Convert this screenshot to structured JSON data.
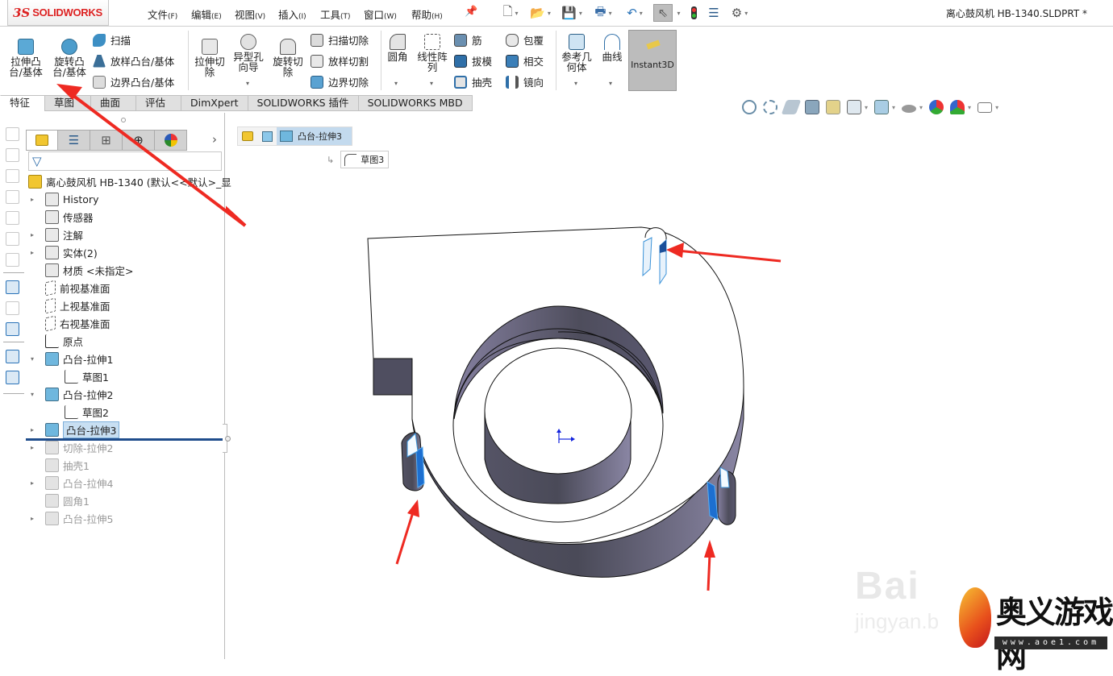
{
  "app": {
    "logo_ds": "3S",
    "logo_text": "SOLIDWORKS",
    "document_title": "离心鼓风机 HB-1340.SLDPRT *"
  },
  "menu": [
    {
      "label": "文件",
      "key": "(F)"
    },
    {
      "label": "编辑",
      "key": "(E)"
    },
    {
      "label": "视图",
      "key": "(V)"
    },
    {
      "label": "插入",
      "key": "(I)"
    },
    {
      "label": "工具",
      "key": "(T)"
    },
    {
      "label": "窗口",
      "key": "(W)"
    },
    {
      "label": "帮助",
      "key": "(H)"
    }
  ],
  "quick_access": [
    "new-icon",
    "open-icon",
    "save-icon",
    "print-icon",
    "undo-icon",
    "select-icon",
    "rebuild-icon",
    "file-properties-icon",
    "options-icon"
  ],
  "ribbon": {
    "large": [
      {
        "label": "拉伸凸台/基体",
        "lines": [
          "拉伸凸",
          "台/基体"
        ]
      },
      {
        "label": "旋转凸台/基体",
        "lines": [
          "旋转凸",
          "台/基体"
        ]
      },
      {
        "label": "拉伸切除",
        "lines": [
          "拉伸切",
          "除"
        ]
      },
      {
        "label": "异型孔向导",
        "lines": [
          "异型孔",
          "向导"
        ]
      },
      {
        "label": "旋转切除",
        "lines": [
          "旋转切",
          "除"
        ]
      },
      {
        "label": "圆角",
        "lines": [
          "圆角"
        ]
      },
      {
        "label": "线性阵列",
        "lines": [
          "线性阵",
          "列"
        ]
      },
      {
        "label": "参考几何体",
        "lines": [
          "参考几",
          "何体"
        ]
      },
      {
        "label": "曲线",
        "lines": [
          "曲线"
        ]
      },
      {
        "label": "Instant3D",
        "lines": [
          "Instant3D"
        ]
      }
    ],
    "small": {
      "sweep": "扫描",
      "loft": "放样凸台/基体",
      "boundary": "边界凸台/基体",
      "sweep_cut": "扫描切除",
      "loft_cut": "放样切割",
      "boundary_cut": "边界切除",
      "rib": "筋",
      "draft": "拔模",
      "shell": "抽壳",
      "wrap": "包覆",
      "intersect": "相交",
      "mirror": "镜向"
    }
  },
  "tabs": [
    {
      "label": "特征",
      "active": true
    },
    {
      "label": "草图"
    },
    {
      "label": "曲面"
    },
    {
      "label": "评估"
    },
    {
      "label": "DimXpert"
    },
    {
      "label": "SOLIDWORKS 插件"
    },
    {
      "label": "SOLIDWORKS MBD"
    }
  ],
  "view_toolbar": [
    "zoom-to-fit-icon",
    "zoom-to-area-icon",
    "previous-view-icon",
    "section-view-icon",
    "dynamic-annotation-icon",
    "view-orientation-icon",
    "display-style-icon",
    "hide-show-icon",
    "edit-appearance-icon",
    "apply-scene-icon",
    "view-settings-icon"
  ],
  "panel_tabs": [
    "feature-manager-icon",
    "property-manager-icon",
    "configuration-manager-icon",
    "dimxpert-manager-icon",
    "display-manager-icon"
  ],
  "tree": {
    "root": "离心鼓风机 HB-1340  (默认<<默认>_显",
    "items": [
      {
        "label": "History",
        "icon": "history-folder-icon",
        "expander": true
      },
      {
        "label": "传感器",
        "icon": "sensors-folder-icon"
      },
      {
        "label": "注解",
        "icon": "annotations-folder-icon",
        "expander": true
      },
      {
        "label": "实体(2)",
        "icon": "solid-bodies-folder-icon",
        "expander": true
      },
      {
        "label": "材质 <未指定>",
        "icon": "material-icon"
      },
      {
        "label": "前视基准面",
        "icon": "plane-icon"
      },
      {
        "label": "上视基准面",
        "icon": "plane-icon"
      },
      {
        "label": "右视基准面",
        "icon": "plane-icon"
      },
      {
        "label": "原点",
        "icon": "origin-icon"
      },
      {
        "label": "凸台-拉伸1",
        "icon": "extrude-icon",
        "expanded": true
      },
      {
        "label": "草图1",
        "icon": "sketch-icon",
        "child": true
      },
      {
        "label": "凸台-拉伸2",
        "icon": "extrude-icon",
        "expanded": true
      },
      {
        "label": "草图2",
        "icon": "sketch-icon",
        "child": true
      },
      {
        "label": "凸台-拉伸3",
        "icon": "extrude-icon",
        "expander": true,
        "selected": true
      },
      {
        "label": "切除-拉伸2",
        "icon": "cut-extrude-icon",
        "expander": true,
        "suppressed": true
      },
      {
        "label": "抽壳1",
        "icon": "shell-icon",
        "suppressed": true
      },
      {
        "label": "凸台-拉伸4",
        "icon": "extrude-icon",
        "expander": true,
        "suppressed": true
      },
      {
        "label": "圆角1",
        "icon": "fillet-icon",
        "suppressed": true
      },
      {
        "label": "凸台-拉伸5",
        "icon": "extrude-icon",
        "expander": true,
        "suppressed": true
      }
    ]
  },
  "breadcrumb": {
    "current": "凸台-拉伸3",
    "sketch": "草图3"
  },
  "watermark": {
    "baidu": "Bai",
    "jingyan": "jingyan.b",
    "site_name": "奥义游戏网",
    "site_url": "www.aoe1.com"
  },
  "colors": {
    "accent": "#2a73b8",
    "brand_red": "#d22222",
    "model_wall": "#5b5a70",
    "annotation_arrow": "#ee2a22"
  }
}
